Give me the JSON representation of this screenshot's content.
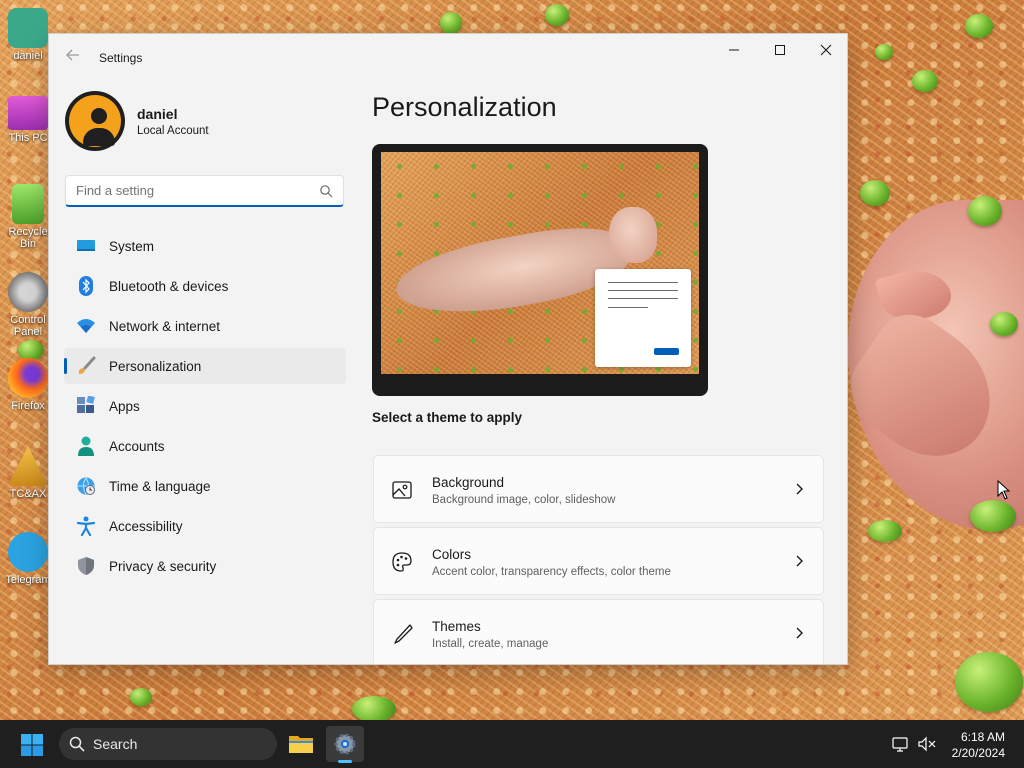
{
  "desktop": {
    "icons": [
      {
        "label": "daniel"
      },
      {
        "label": "This PC"
      },
      {
        "label": "Recycle Bin"
      },
      {
        "label": "Control Panel"
      },
      {
        "label": "Firefox"
      },
      {
        "label": "TC&AX"
      },
      {
        "label": "Telegram"
      }
    ]
  },
  "window": {
    "title": "Settings",
    "back_icon": "arrow-left-icon",
    "controls": [
      "minimize-icon",
      "maximize-icon",
      "close-icon"
    ]
  },
  "user": {
    "name": "daniel",
    "account_type": "Local Account"
  },
  "search": {
    "placeholder": "Find a setting",
    "value": ""
  },
  "sidebar": {
    "items": [
      {
        "label": "System",
        "icon": "monitor-icon",
        "active": false
      },
      {
        "label": "Bluetooth & devices",
        "icon": "bluetooth-icon",
        "active": false
      },
      {
        "label": "Network & internet",
        "icon": "wifi-icon",
        "active": false
      },
      {
        "label": "Personalization",
        "icon": "paintbrush-icon",
        "active": true
      },
      {
        "label": "Apps",
        "icon": "apps-grid-icon",
        "active": false
      },
      {
        "label": "Accounts",
        "icon": "person-icon",
        "active": false
      },
      {
        "label": "Time & language",
        "icon": "globe-clock-icon",
        "active": false
      },
      {
        "label": "Accessibility",
        "icon": "accessibility-icon",
        "active": false
      },
      {
        "label": "Privacy & security",
        "icon": "shield-icon",
        "active": false
      }
    ]
  },
  "main": {
    "title": "Personalization",
    "theme_prompt": "Select a theme to apply",
    "cards": [
      {
        "title": "Background",
        "description": "Background image, color, slideshow",
        "icon": "picture-icon"
      },
      {
        "title": "Colors",
        "description": "Accent color, transparency effects, color theme",
        "icon": "palette-icon"
      },
      {
        "title": "Themes",
        "description": "Install, create, manage",
        "icon": "brush-pen-icon"
      }
    ]
  },
  "taskbar": {
    "search_label": "Search",
    "apps": [
      "file-explorer-icon",
      "settings-gear-icon"
    ],
    "time": "6:18 AM",
    "date": "2/20/2024"
  },
  "colors": {
    "accent": "#005fb8",
    "taskbar": "#1f1f1f",
    "window_bg": "#f3f3f3"
  }
}
